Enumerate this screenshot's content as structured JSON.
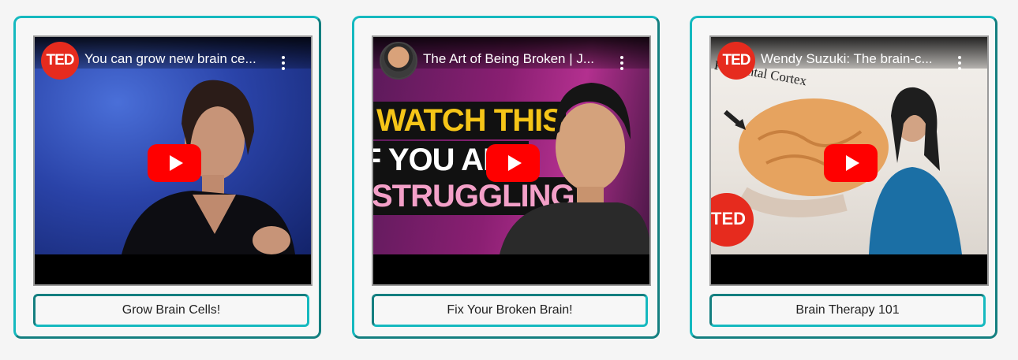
{
  "cards": [
    {
      "video_title": "You can grow new brain ce...",
      "channel_avatar": "TED",
      "button_label": "Grow Brain Cells!"
    },
    {
      "video_title": "The Art of Being Broken | J...",
      "channel_avatar": "",
      "thumbnail_text": [
        "WATCH THIS",
        "F YOU ARE",
        "STRUGGLING"
      ],
      "button_label": "Fix Your Broken Brain!"
    },
    {
      "video_title": "Wendy Suzuki: The brain-c...",
      "channel_avatar": "TED",
      "thumbnail_text": [
        "Prefrontal Cortex",
        "TED"
      ],
      "button_label": "Brain Therapy 101"
    }
  ],
  "colors": {
    "card_border": "#15b9bf",
    "card_border_dark": "#147f80",
    "play_button": "#ff0000",
    "ted_red": "#e62b1e"
  },
  "icons": [
    "play-icon",
    "more-options-icon",
    "ted-logo-icon",
    "channel-avatar-icon"
  ]
}
